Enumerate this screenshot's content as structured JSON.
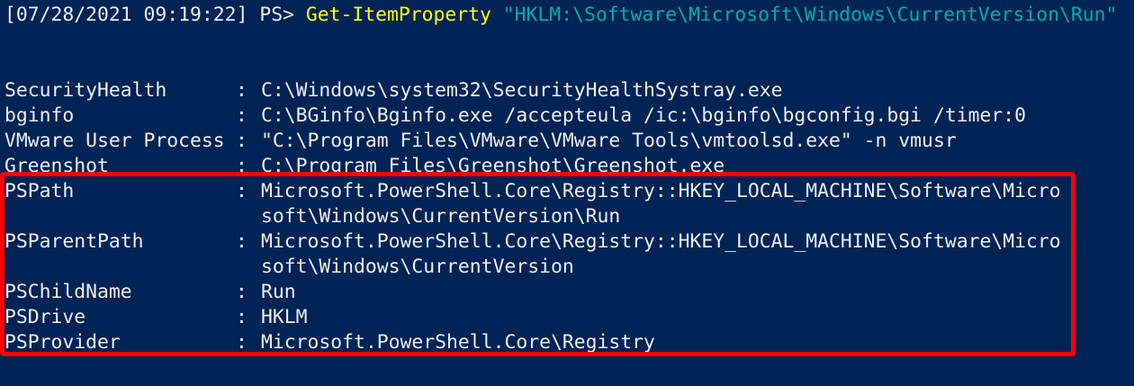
{
  "prompt": {
    "prefix": "[07/28/2021 09:19:22] PS> ",
    "command": "Get-ItemProperty",
    "argument": "\"HKLM:\\Software\\Microsoft\\Windows\\CurrentVersion\\Run\""
  },
  "entries": [
    {
      "name": "SecurityHealth",
      "value": "C:\\Windows\\system32\\SecurityHealthSystray.exe"
    },
    {
      "name": "bginfo",
      "value": "C:\\BGinfo\\Bginfo.exe /accepteula /ic:\\bginfo\\bgconfig.bgi /timer:0"
    },
    {
      "name": "VMware User Process",
      "value": "\"C:\\Program Files\\VMware\\VMware Tools\\vmtoolsd.exe\" -n vmusr"
    },
    {
      "name": "Greenshot",
      "value": "C:\\Program Files\\Greenshot\\Greenshot.exe"
    },
    {
      "name": "PSPath",
      "value": "Microsoft.PowerShell.Core\\Registry::HKEY_LOCAL_MACHINE\\Software\\Micro",
      "continuation": "soft\\Windows\\CurrentVersion\\Run"
    },
    {
      "name": "PSParentPath",
      "value": "Microsoft.PowerShell.Core\\Registry::HKEY_LOCAL_MACHINE\\Software\\Micro",
      "continuation": "soft\\Windows\\CurrentVersion"
    },
    {
      "name": "PSChildName",
      "value": "Run"
    },
    {
      "name": "PSDrive",
      "value": "HKLM"
    },
    {
      "name": "PSProvider",
      "value": "Microsoft.PowerShell.Core\\Registry"
    }
  ],
  "separator": ": ",
  "colors": {
    "background": "#012456",
    "text": "#eeedf0",
    "command": "#ffff00",
    "string": "#00aaaa",
    "highlight": "#ff0000"
  }
}
